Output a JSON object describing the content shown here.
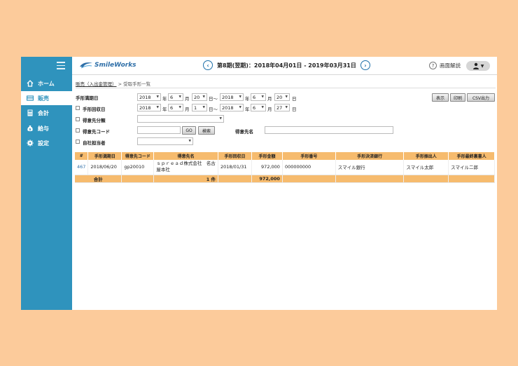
{
  "sidebar": {
    "items": [
      {
        "label": "ホーム",
        "icon": "home-icon"
      },
      {
        "label": "販売",
        "icon": "sales-icon"
      },
      {
        "label": "会計",
        "icon": "accounting-icon"
      },
      {
        "label": "給与",
        "icon": "payroll-icon"
      },
      {
        "label": "設定",
        "icon": "settings-icon"
      }
    ]
  },
  "header": {
    "logo": "SmileWorks",
    "period": "第8期(翌期)：2018年04月01日 - 2019年03月31日",
    "help": "画面解説"
  },
  "breadcrumb": {
    "parent": "販売（入出金管理）",
    "sep": ">",
    "current": "受取手形一覧"
  },
  "form": {
    "due_date_label": "手形満期日",
    "collect_date_label": "手形回収日",
    "category_label": "得意先分類",
    "customer_code_label": "得意先コード",
    "customer_name_label": "得意先名",
    "staff_label": "自社担当者",
    "year_unit": "年",
    "month_unit": "月",
    "day_unit": "日",
    "range_sep": "日〜",
    "due_from": {
      "y": "2018",
      "m": "6",
      "d": "20"
    },
    "due_to": {
      "y": "2018",
      "m": "6",
      "d": "20"
    },
    "collect_from": {
      "y": "2018",
      "m": "6",
      "d": "1"
    },
    "collect_to": {
      "y": "2018",
      "m": "6",
      "d": "27"
    },
    "go_label": "GO",
    "search_label": "検索"
  },
  "actions": {
    "show": "表示",
    "print": "印刷",
    "csv": "CSV出力"
  },
  "table": {
    "headers": [
      "#",
      "手形満期日",
      "得意先コード",
      "得意先名",
      "手形回収日",
      "手形金額",
      "手形番号",
      "手形決済銀行",
      "手形振出人",
      "手形最終裏書人"
    ],
    "rows": [
      {
        "id": "467",
        "due": "2018/06/20",
        "code": "gp20010",
        "name": "ｓｐｒｅａｄ株式会社　名古屋本社",
        "collect": "2018/01/31",
        "amount": "972,000",
        "number": "000000000",
        "bank": "スマイル銀行",
        "drawer": "スマイル太郎",
        "endorser": "スマイル二郎"
      }
    ],
    "total": {
      "label": "合計",
      "count": "1 件",
      "amount": "972,000"
    }
  }
}
